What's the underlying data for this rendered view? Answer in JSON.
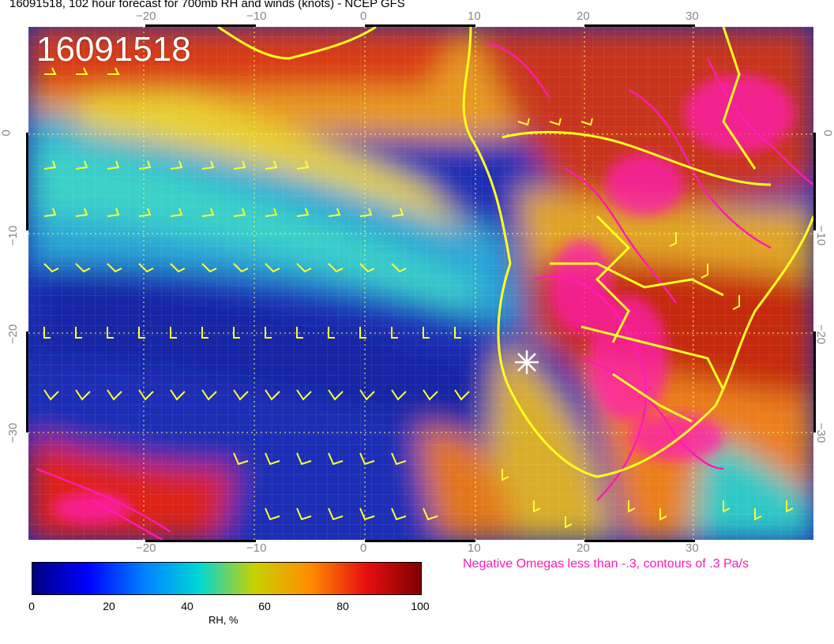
{
  "header": {
    "title": "16091518, 102 hour forecast for 700mb RH and winds (knots) - NCEP GFS"
  },
  "map": {
    "run_stamp": "16091518",
    "lon_ticks": [
      "−20",
      "−10",
      "0",
      "10",
      "20",
      "30"
    ],
    "lat_ticks": [
      "0",
      "−10",
      "−20",
      "−30"
    ],
    "overlay_color": "#ff1ab4",
    "vector_color": "#ffff33",
    "marker_icon": "white-star-marker"
  },
  "legend": {
    "omega_note": "Negative Omegas less than -.3, contours of .3 Pa/s",
    "colorbar_ticks": [
      "0",
      "20",
      "40",
      "60",
      "80",
      "100"
    ],
    "colorbar_label": "RH, %",
    "colorbar_stops": [
      "#00007f",
      "#0000ff",
      "#0080ff",
      "#00d6d6",
      "#c8d200",
      "#ff8c00",
      "#e81010",
      "#7f0000"
    ]
  }
}
